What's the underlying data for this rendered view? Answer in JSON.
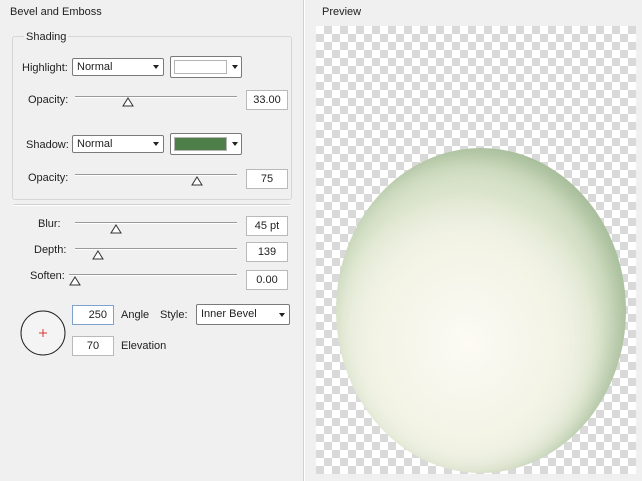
{
  "panel": {
    "title": "Bevel and Emboss",
    "shading_title": "Shading",
    "highlight": {
      "label": "Highlight:",
      "mode": "Normal",
      "color": "#ffffff",
      "opacity_label": "Opacity:",
      "opacity_value": "33.00",
      "opacity_level": 0.33
    },
    "shadow": {
      "label": "Shadow:",
      "mode": "Normal",
      "color": "#4e7f48",
      "opacity_label": "Opacity:",
      "opacity_value": "75",
      "opacity_level": 0.75
    },
    "blur": {
      "label": "Blur:",
      "value": "45 pt",
      "level": 0.25
    },
    "depth": {
      "label": "Depth:",
      "value": "139",
      "level": 0.14
    },
    "soften": {
      "label": "Soften:",
      "value": "0.00",
      "level": 0.0
    },
    "angle": {
      "value": "250",
      "label": "Angle"
    },
    "elevation": {
      "value": "70",
      "label": "Elevation"
    },
    "style": {
      "label": "Style:",
      "value": "Inner Bevel"
    }
  },
  "preview": {
    "title": "Preview",
    "sphere_colors": {
      "center": "#fcfbf4",
      "edge": "#9fbb8f"
    }
  }
}
